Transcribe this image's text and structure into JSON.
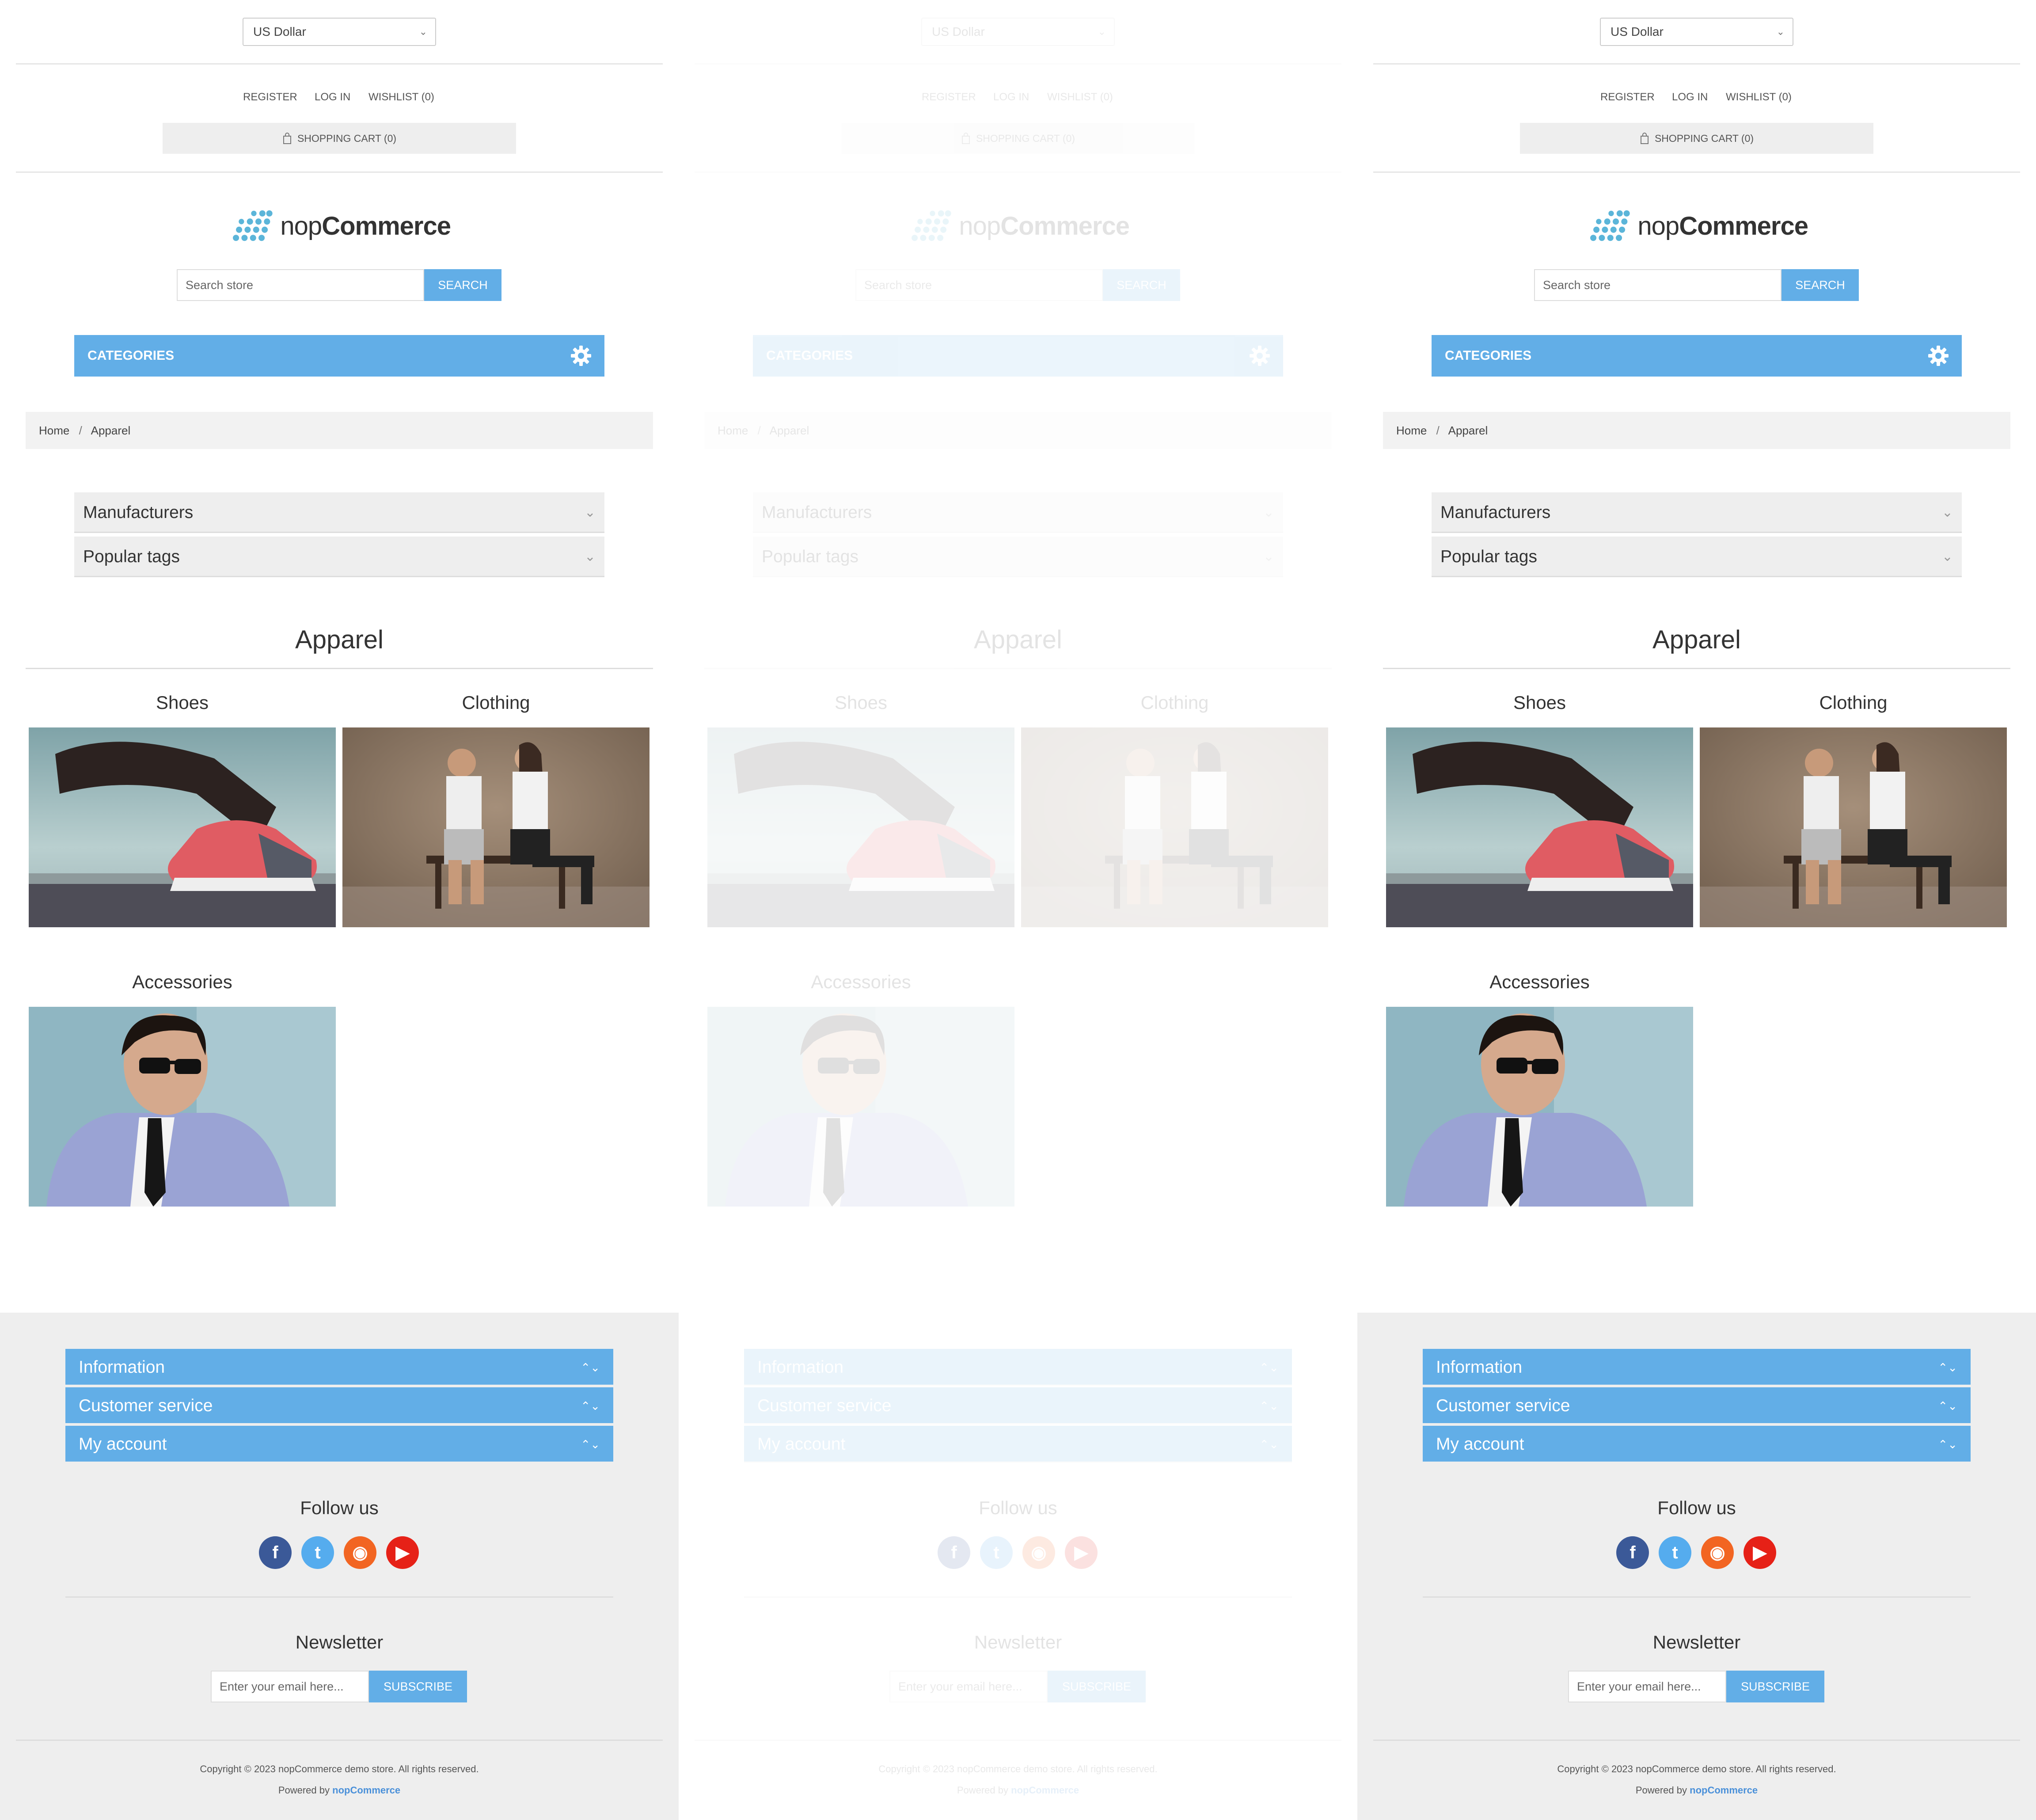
{
  "header": {
    "currency": "US Dollar",
    "links": {
      "register": "REGISTER",
      "login": "LOG IN",
      "wishlist": "WISHLIST (0)"
    },
    "cart": "SHOPPING CART (0)"
  },
  "logo": {
    "brand_light": "nop",
    "brand_bold": "Commerce"
  },
  "search": {
    "placeholder": "Search store",
    "button": "SEARCH"
  },
  "categories_bar": {
    "label": "CATEGORIES"
  },
  "breadcrumb": {
    "home": "Home",
    "separator": "/",
    "current": "Apparel"
  },
  "side_blocks": {
    "manufacturers": "Manufacturers",
    "popular_tags": "Popular tags"
  },
  "page": {
    "title": "Apparel",
    "subcategories": [
      {
        "name": "Shoes"
      },
      {
        "name": "Clothing"
      },
      {
        "name": "Accessories"
      }
    ]
  },
  "footer": {
    "sections": [
      "Information",
      "Customer service",
      "My account"
    ],
    "follow_us": "Follow us",
    "social": [
      {
        "name": "facebook-icon",
        "glyph": "f",
        "color": "#3b5998"
      },
      {
        "name": "twitter-icon",
        "glyph": "t",
        "color": "#55acee"
      },
      {
        "name": "rss-icon",
        "glyph": "◉",
        "color": "#f26522"
      },
      {
        "name": "youtube-icon",
        "glyph": "▶",
        "color": "#e62117"
      }
    ],
    "newsletter": {
      "heading": "Newsletter",
      "placeholder": "Enter your email here...",
      "button": "SUBSCRIBE"
    },
    "copyright": "Copyright © 2023 nopCommerce demo store. All rights reserved.",
    "powered_by": "Powered by",
    "powered_brand": "nopCommerce"
  },
  "colors": {
    "accent": "#62aee7",
    "footer_bg": "#eeeeee",
    "link": "#4a90d9"
  }
}
